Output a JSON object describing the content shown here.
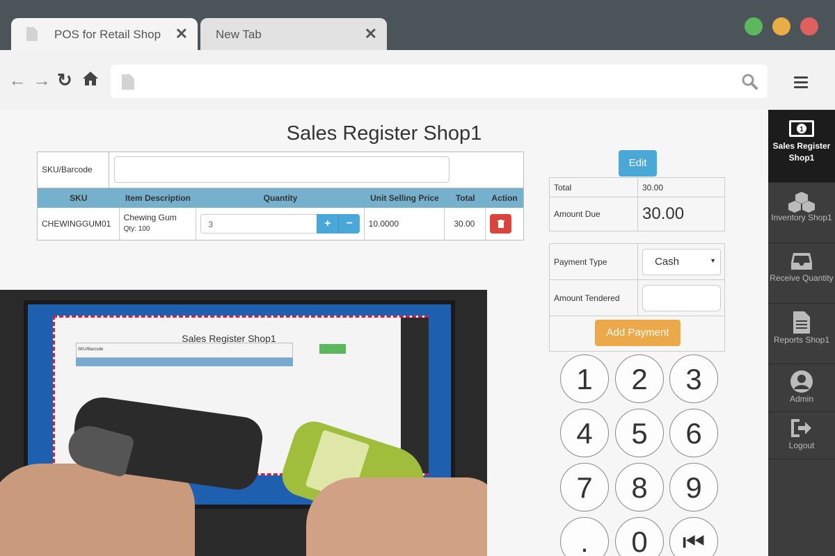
{
  "browser": {
    "tabs": [
      {
        "label": "POS for Retail Shop",
        "close": "✕"
      },
      {
        "label": "New Tab",
        "close": "✕"
      }
    ],
    "nav": {
      "back": "←",
      "forward": "→",
      "reload": "↻",
      "home": "⌂"
    }
  },
  "page": {
    "title": "Sales Register Shop1"
  },
  "register": {
    "sku_label": "SKU/Barcode",
    "columns": [
      "SKU",
      "Item Description",
      "Quantity",
      "Unit Selling Price",
      "Total",
      "Action"
    ],
    "items": [
      {
        "sku": "CHEWINGGUM01",
        "description": "Chewing Gum",
        "qty_note": "Qty: 100",
        "quantity": "3",
        "unit_price": "10.0000",
        "total": "30.00"
      }
    ],
    "qty_plus": "+",
    "qty_minus": "−",
    "delete_icon": "trash-icon"
  },
  "totals": {
    "edit_label": "Edit",
    "total_label": "Total",
    "total_value": "30.00",
    "amount_due_label": "Amount Due",
    "amount_due_value": "30.00"
  },
  "payment": {
    "type_label": "Payment Type",
    "type_value": "Cash",
    "tendered_label": "Amount Tendered",
    "tendered_value": "",
    "add_payment_label": "Add Payment"
  },
  "keypad": [
    "1",
    "2",
    "3",
    "4",
    "5",
    "6",
    "7",
    "8",
    "9",
    ".",
    "0",
    "⏮"
  ],
  "sidebar": [
    {
      "label": "Sales Register Shop1",
      "icon": "money-icon",
      "active": true
    },
    {
      "label": "Inventory Shop1",
      "icon": "boxes-icon"
    },
    {
      "label": "Receive Quantity",
      "icon": "inbox-icon"
    },
    {
      "label": "Reports Shop1",
      "icon": "document-icon"
    },
    {
      "label": "Admin",
      "icon": "user-icon"
    },
    {
      "label": "Logout",
      "icon": "logout-icon"
    }
  ],
  "video": {
    "inner_title": "Sales Register Shop1",
    "inner_sku": "SKU/Barcode"
  },
  "colors": {
    "accent_blue": "#4aa8d8",
    "danger": "#d9453c",
    "warning": "#eca94a",
    "header_blue": "#75b1cd"
  }
}
